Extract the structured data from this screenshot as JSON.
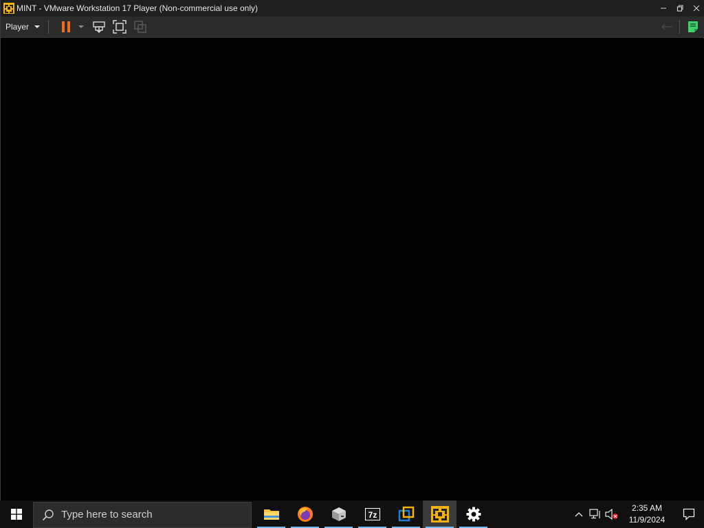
{
  "window": {
    "title": "MINT - VMware Workstation 17 Player (Non-commercial use only)",
    "controls": [
      "minimize-icon",
      "restore-icon",
      "close-icon"
    ]
  },
  "toolbar": {
    "player_label": "Player",
    "buttons": [
      {
        "name": "pause-icon",
        "color": "#f26b21"
      },
      {
        "name": "send-ctrl-alt-del-icon"
      },
      {
        "name": "full-screen-icon"
      },
      {
        "name": "unity-icon",
        "disabled": true
      }
    ],
    "right_icons": [
      "back-arrow-icon",
      "message-log-icon"
    ]
  },
  "taskbar": {
    "search_placeholder": "Type here to search",
    "apps": [
      {
        "name": "file-explorer-icon",
        "running": true
      },
      {
        "name": "firefox-icon",
        "running": true
      },
      {
        "name": "app-installer-icon",
        "running": true
      },
      {
        "name": "7zip-icon",
        "label": "7z",
        "running": true
      },
      {
        "name": "virtualbox-icon",
        "running": true
      },
      {
        "name": "vmware-player-icon",
        "running": true,
        "active": true
      },
      {
        "name": "settings-icon",
        "running": true
      }
    ],
    "tray": {
      "time": "2:35 AM",
      "date": "11/9/2024"
    }
  },
  "colors": {
    "accent": "#76b9ed",
    "pause": "#f26b21",
    "vmware": "#f5b400",
    "notes": "#3fcf6b"
  }
}
